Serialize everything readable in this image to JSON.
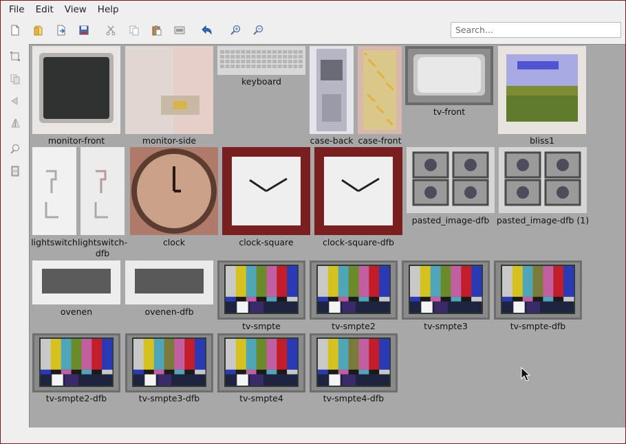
{
  "menubar": {
    "file": "File",
    "edit": "Edit",
    "view": "View",
    "help": "Help"
  },
  "toolbar": {
    "icons": [
      "new-file-icon",
      "open-folder-icon",
      "import-icon",
      "save-icon",
      "cut-icon",
      "copy-icon",
      "paste-icon",
      "image-icon",
      "undo-icon",
      "zoom-in-icon",
      "zoom-out-icon"
    ]
  },
  "search": {
    "placeholder": "Search...",
    "value": ""
  },
  "sidebar": {
    "icons": [
      "select-rect-icon",
      "layers-icon",
      "flip-horizontal-icon",
      "flip-vertical-icon",
      "magnifier-icon",
      "film-icon"
    ]
  },
  "assets": [
    {
      "name": "monitor-front"
    },
    {
      "name": "monitor-side"
    },
    {
      "name": "keyboard"
    },
    {
      "name": "case-back"
    },
    {
      "name": "case-front"
    },
    {
      "name": "tv-front"
    },
    {
      "name": "bliss1"
    },
    {
      "name": "lightswitch"
    },
    {
      "name": "lightswitch-dfb"
    },
    {
      "name": "clock"
    },
    {
      "name": "clock-square"
    },
    {
      "name": "clock-square-dfb"
    },
    {
      "name": "pasted_image-dfb"
    },
    {
      "name": "pasted_image-dfb (1)"
    },
    {
      "name": "ovenen"
    },
    {
      "name": "ovenen-dfb"
    },
    {
      "name": "tv-smpte"
    },
    {
      "name": "tv-smpte2"
    },
    {
      "name": "tv-smpte3"
    },
    {
      "name": "tv-smpte-dfb"
    },
    {
      "name": "tv-smpte2-dfb"
    },
    {
      "name": "tv-smpte3-dfb"
    },
    {
      "name": "tv-smpte4"
    },
    {
      "name": "tv-smpte4-dfb"
    }
  ],
  "colors": {
    "canvas_bg": "#a8a8a8",
    "window_bg": "#efefef",
    "frame_border": "#7a1a1a"
  }
}
